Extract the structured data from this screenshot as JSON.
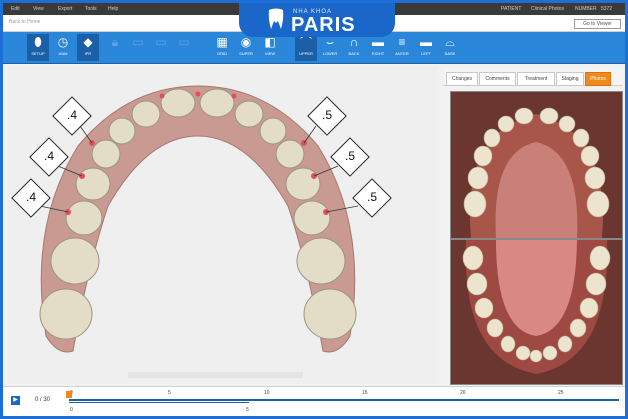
{
  "menu": {
    "items": [
      "Edit",
      "View",
      "Export",
      "Tools",
      "Help"
    ],
    "right": [
      "PATIENT",
      "Clinical Photos",
      "NUMBER",
      "5372"
    ]
  },
  "address": {
    "back": "Back to Home",
    "goto": "Go to Viewer"
  },
  "brand": {
    "sub": "NHA KHOA",
    "name": "PARIS"
  },
  "toolbar": {
    "buttons": [
      {
        "label": "SETUP",
        "icon": "tooth"
      },
      {
        "label": "ANM",
        "icon": "clock"
      },
      {
        "label": "IPR",
        "icon": "diamond"
      },
      {
        "label": "",
        "icon": "lock"
      },
      {
        "label": "",
        "icon": "square"
      },
      {
        "label": "",
        "icon": "square"
      },
      {
        "label": "",
        "icon": "square"
      },
      {
        "label": "GRID",
        "icon": "grid"
      },
      {
        "label": "SUPER",
        "icon": "overlay"
      },
      {
        "label": "VIEW",
        "icon": "view"
      },
      {
        "label": "UPPER",
        "icon": "upper"
      },
      {
        "label": "LOWER",
        "icon": "lower"
      },
      {
        "label": "BACK",
        "icon": "arch"
      },
      {
        "label": "RIGHT",
        "icon": "right"
      },
      {
        "label": "ANTER",
        "icon": "front"
      },
      {
        "label": "LEFT",
        "icon": "left"
      },
      {
        "label": "BASE",
        "icon": "base"
      }
    ]
  },
  "ipr_labels": [
    ".4",
    ".4",
    ".4",
    ".5",
    ".5",
    ".5"
  ],
  "tabs": [
    "Changes",
    "Comments",
    "Treatment",
    "Staging",
    "Photos"
  ],
  "timeline": {
    "play": "▶",
    "counter": "0 / 30",
    "ticks": [
      "0",
      "5",
      "10",
      "15",
      "20",
      "25"
    ],
    "sub_ticks": [
      "0",
      "5"
    ]
  },
  "colors": {
    "accent": "#f08a1c",
    "toolbar": "#2a86d8",
    "brand": "#1a67c9"
  }
}
